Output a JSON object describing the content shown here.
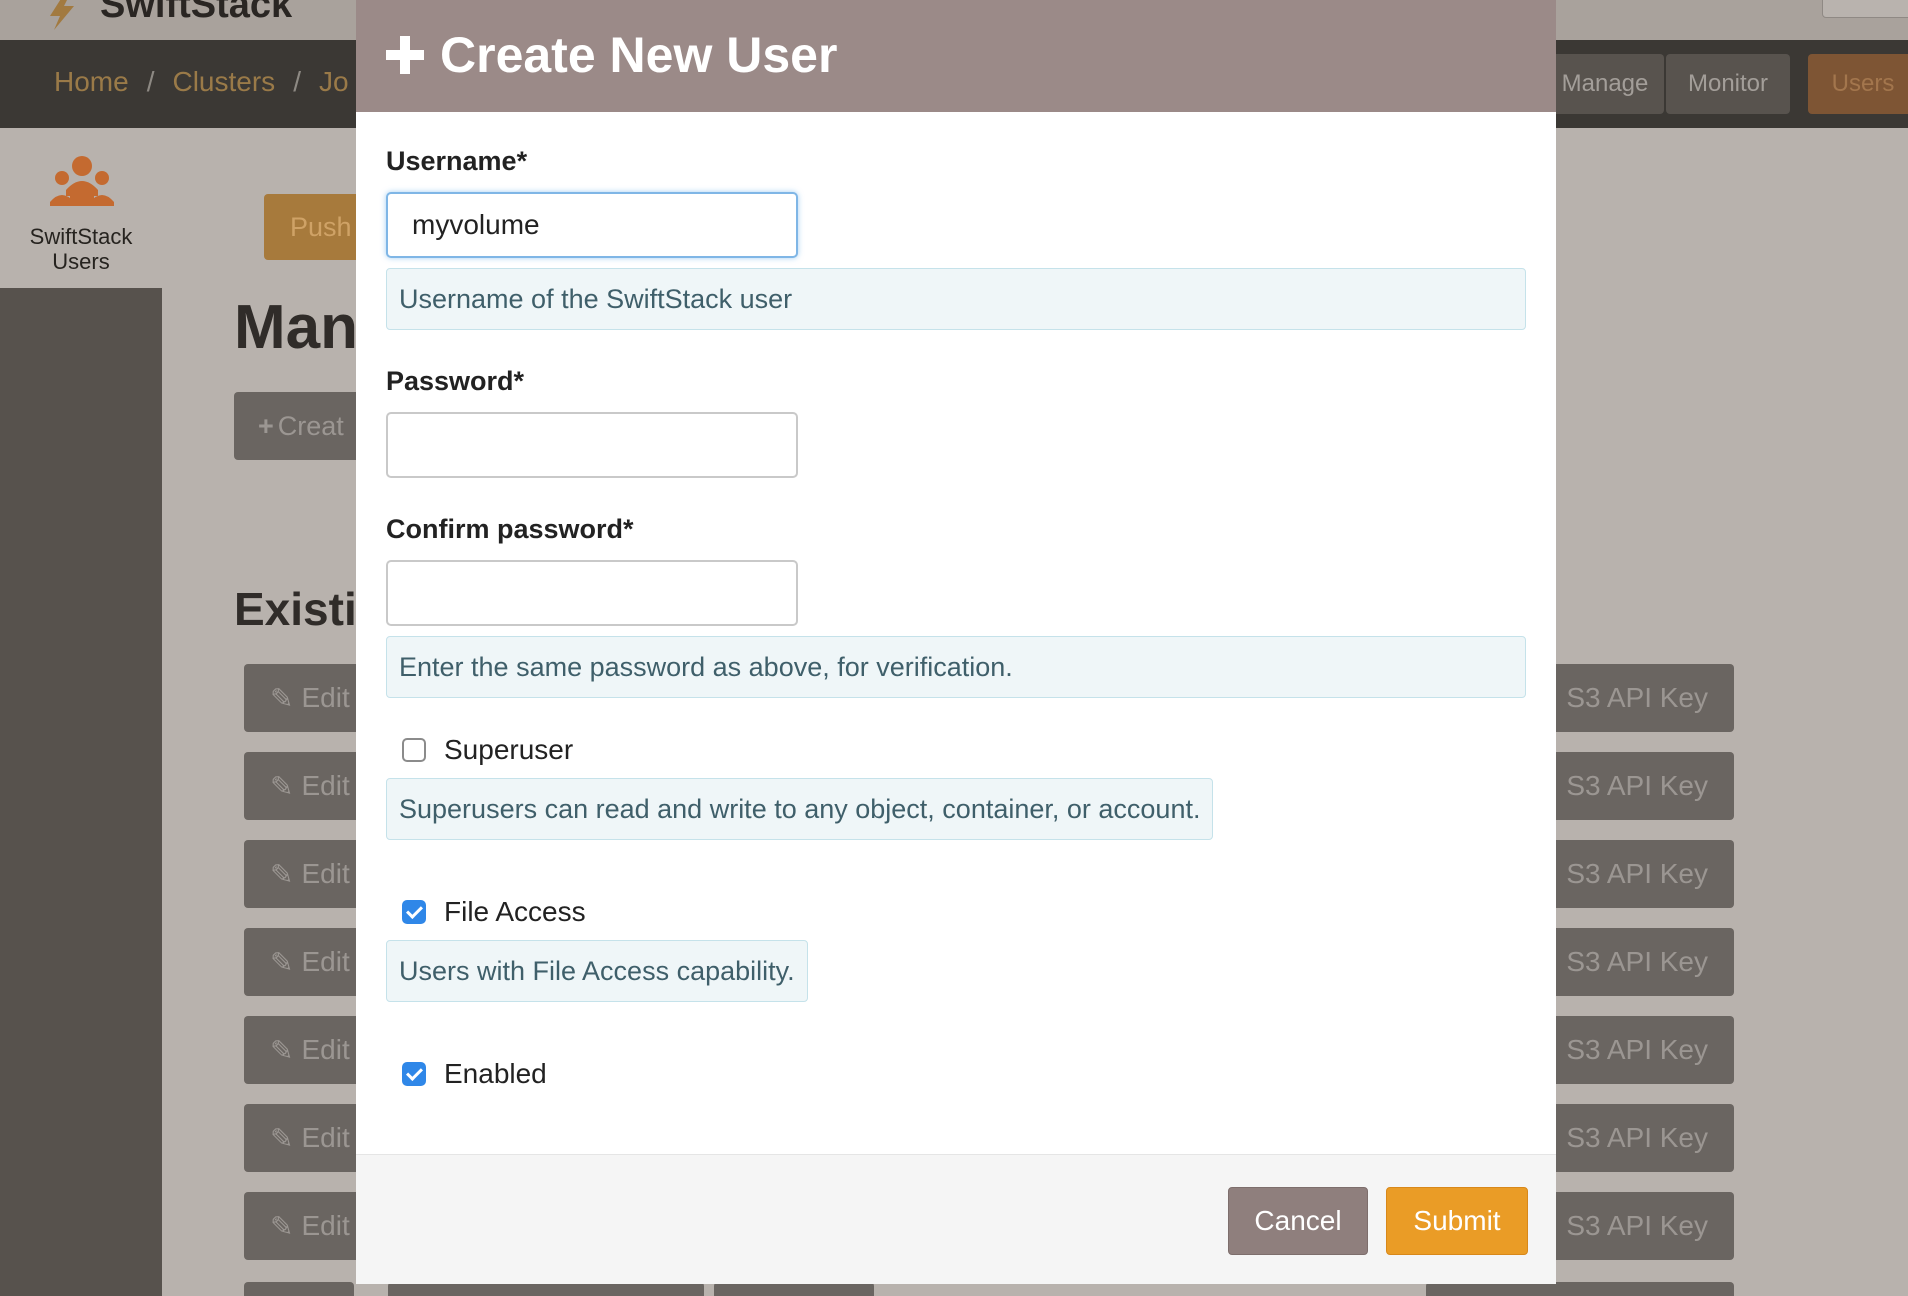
{
  "background": {
    "logo_text": "SwiftStack",
    "breadcrumb": [
      "Home",
      "Clusters",
      "Jo"
    ],
    "nav_buttons": {
      "manage": "Manage",
      "monitor": "Monitor",
      "users": "Users"
    },
    "sidebar": {
      "item_label_line1": "SwiftStack",
      "item_label_line2": "Users",
      "icon": "users-icon"
    },
    "push_button": "Push",
    "heading": "Man",
    "create_button": "Creat",
    "existing_heading": "Existi",
    "rows": [
      {
        "edit": "Edit",
        "key": "S3 API Key"
      },
      {
        "edit": "Edit",
        "key": "S3 API Key"
      },
      {
        "edit": "Edit",
        "key": "S3 API Key"
      },
      {
        "edit": "Edit",
        "key": "S3 API Key"
      },
      {
        "edit": "Edit",
        "key": "S3 API Key"
      },
      {
        "edit": "Edit",
        "key": "S3 API Key"
      },
      {
        "edit": "Edit",
        "key": "S3 API Key"
      }
    ]
  },
  "modal": {
    "title": "Create New User",
    "title_icon": "plus-icon",
    "username": {
      "label": "Username*",
      "value": "myvolume",
      "help": "Username of the SwiftStack user"
    },
    "password": {
      "label": "Password*",
      "value": ""
    },
    "confirm_password": {
      "label": "Confirm password*",
      "value": "",
      "help": "Enter the same password as above, for verification."
    },
    "superuser": {
      "label": "Superuser",
      "checked": false,
      "help": "Superusers can read and write to any object, container, or account."
    },
    "file_access": {
      "label": "File Access",
      "checked": true,
      "help": "Users with File Access capability."
    },
    "enabled": {
      "label": "Enabled",
      "checked": true
    },
    "buttons": {
      "cancel": "Cancel",
      "submit": "Submit"
    }
  },
  "colors": {
    "header": "#9b8a88",
    "submit": "#ea9c26",
    "cancel": "#8f7f7d",
    "checkbox": "#2f87e8"
  }
}
